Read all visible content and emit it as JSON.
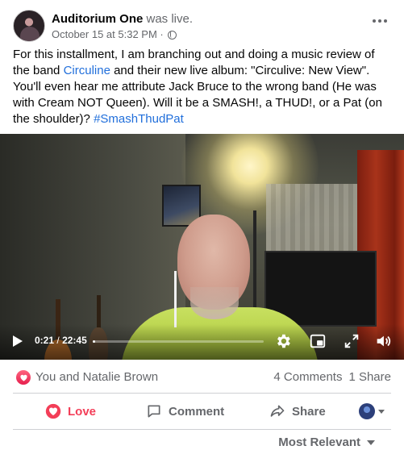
{
  "post": {
    "author": "Auditorium One",
    "status": "was live.",
    "timestamp": "October 15 at 5:32 PM",
    "separator": "·",
    "privacy_icon": "globe-icon",
    "text": {
      "part1": "For this installment, I am branching out and doing a music review of the band ",
      "link_band": "Circuline",
      "part2": " and their new live album: \"Circulive: New View\". You'll even hear me attribute Jack Bruce to the wrong band (He was with Cream NOT Queen). Will it be a SMASH!, a THUD!, or a Pat (on the shoulder)? ",
      "hashtag": "#SmashThudPat"
    }
  },
  "video": {
    "current_time": "0:21",
    "time_separator": "/",
    "duration": "22:45",
    "progress_fraction": 0.015
  },
  "reactions": {
    "summary_names": "You and Natalie Brown",
    "comments": "4 Comments",
    "shares": "1 Share"
  },
  "actions": {
    "love_label": "Love",
    "comment_label": "Comment",
    "share_label": "Share"
  },
  "comments_sort": {
    "label": "Most Relevant"
  },
  "colors": {
    "link": "#216fdb",
    "love": "#f33e58",
    "muted_text": "#65676b"
  }
}
